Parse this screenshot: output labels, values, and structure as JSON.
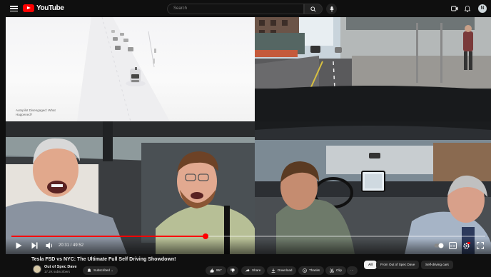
{
  "masthead": {
    "logo_text": "YouTube",
    "search_placeholder": "Search",
    "avatar_letter": "N"
  },
  "video": {
    "panel_top_left_caption_line1": "Autopilot Disengaged: What",
    "panel_top_left_caption_line2": "Happened?",
    "time_display": "20:31 / 49:52",
    "progress_fraction": 0.41
  },
  "meta": {
    "title": "Tesla FSD vs NYC: The Ultimate Full Self Driving Showdown!",
    "channel_name": "Out of Spec Dave",
    "subscribers": "17.2K subscribers",
    "subscribed_label": "Subscribed",
    "like_count": "957",
    "share_label": "Share",
    "download_label": "Download",
    "thanks_label": "Thanks",
    "clip_label": "Clip",
    "more_label": "···"
  },
  "chips": [
    {
      "label": "All"
    },
    {
      "label": "From Out of Spec Dave"
    },
    {
      "label": "Self-driving cars"
    }
  ],
  "colors": {
    "brand_red": "#ff0000",
    "background": "#0f0f0f",
    "pill_bg": "#272727"
  }
}
